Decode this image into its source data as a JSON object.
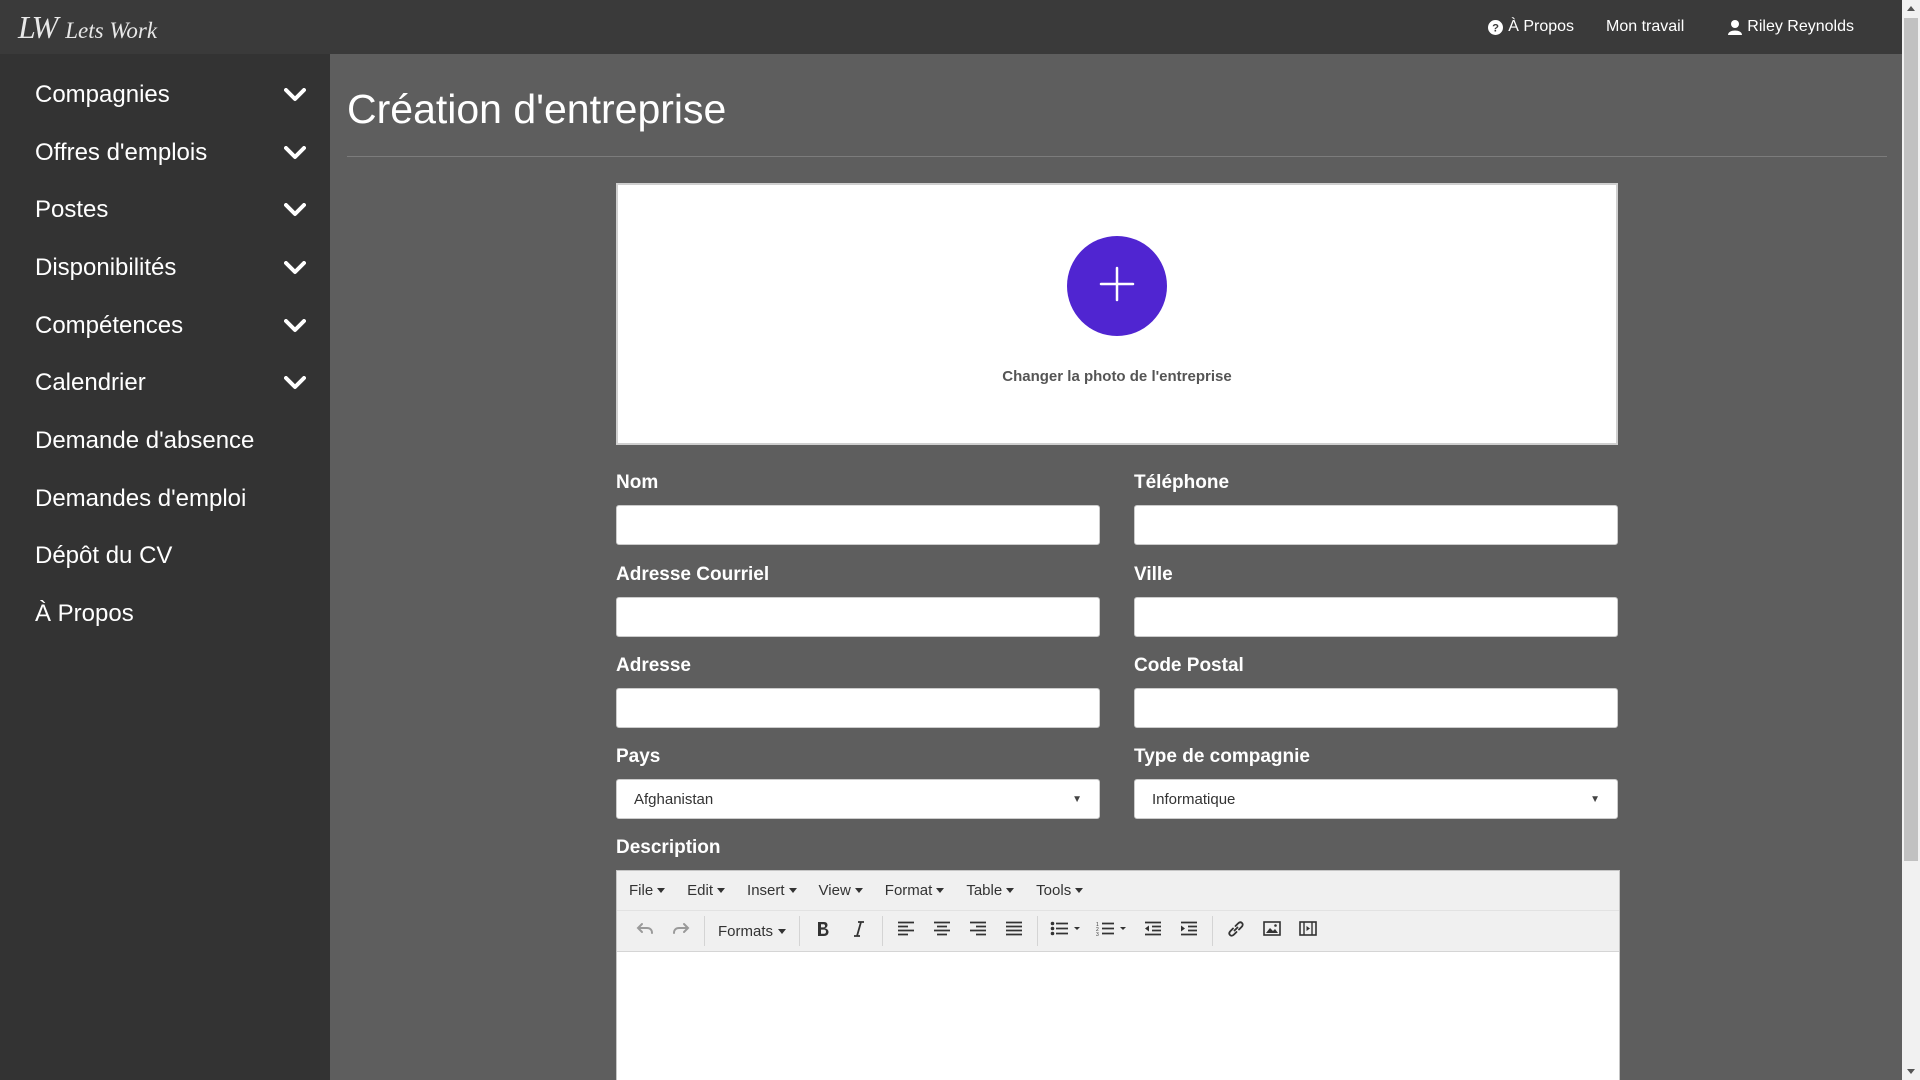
{
  "navbar": {
    "brand_logo": "LW",
    "brand_name": "Lets Work",
    "links": [
      {
        "label": "À Propos",
        "icon": "question-circle-icon"
      },
      {
        "label": "Mon travail"
      },
      {
        "label": "Riley Reynolds",
        "icon": "user-icon"
      }
    ]
  },
  "sidebar": {
    "items": [
      {
        "label": "Compagnies",
        "expandable": true
      },
      {
        "label": "Offres d'emplois",
        "expandable": true
      },
      {
        "label": "Postes",
        "expandable": true
      },
      {
        "label": "Disponibilités",
        "expandable": true
      },
      {
        "label": "Compétences",
        "expandable": true
      },
      {
        "label": "Calendrier",
        "expandable": true
      },
      {
        "label": "Demande d'absence",
        "expandable": false
      },
      {
        "label": "Demandes d'emploi",
        "expandable": false
      },
      {
        "label": "Dépôt du CV",
        "expandable": false
      },
      {
        "label": "À Propos",
        "expandable": false
      }
    ]
  },
  "page": {
    "title": "Création d'entreprise",
    "photo_caption": "Changer la photo de l'entreprise",
    "accent_color": "#5025d1"
  },
  "form": {
    "nom": {
      "label": "Nom",
      "value": ""
    },
    "telephone": {
      "label": "Téléphone",
      "value": ""
    },
    "courriel": {
      "label": "Adresse Courriel",
      "value": ""
    },
    "ville": {
      "label": "Ville",
      "value": ""
    },
    "adresse": {
      "label": "Adresse",
      "value": ""
    },
    "code_postal": {
      "label": "Code Postal",
      "value": ""
    },
    "pays": {
      "label": "Pays",
      "value": "Afghanistan"
    },
    "type": {
      "label": "Type de compagnie",
      "value": "Informatique"
    },
    "description": {
      "label": "Description"
    }
  },
  "editor": {
    "menus": [
      "File",
      "Edit",
      "Insert",
      "View",
      "Format",
      "Table",
      "Tools"
    ],
    "formats_label": "Formats"
  }
}
